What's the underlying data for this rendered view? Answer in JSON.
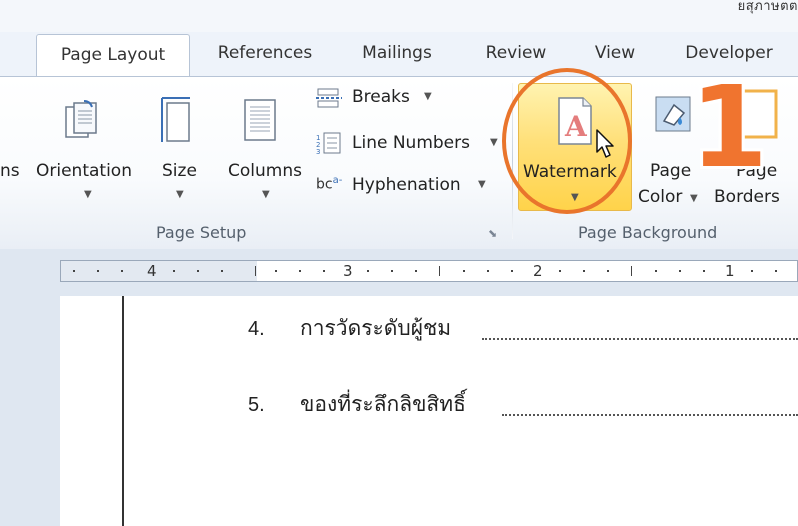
{
  "window": {
    "title_fragment": "ยสุภาษตต"
  },
  "tabs": [
    {
      "label": "Page Layout",
      "active": true
    },
    {
      "label": "References"
    },
    {
      "label": "Mailings"
    },
    {
      "label": "Review"
    },
    {
      "label": "View"
    },
    {
      "label": "Developer"
    }
  ],
  "ribbon": {
    "page_setup": {
      "label": "Page Setup",
      "margins_partial": "ns",
      "orientation": "Orientation",
      "size": "Size",
      "columns": "Columns",
      "breaks": "Breaks",
      "line_numbers": "Line Numbers",
      "hyphenation": "Hyphenation",
      "hyphen_icon_text": "bc"
    },
    "page_background": {
      "label": "Page Background",
      "watermark": "Watermark",
      "page_color_line1": "Page",
      "page_color_line2": "Color",
      "page_borders_line1": "Page",
      "page_borders_line2": "Borders"
    }
  },
  "annotation": {
    "step": "1",
    "ring_color": "#e9752c"
  },
  "ruler": {
    "numbers": [
      "4",
      "3",
      "2",
      "1"
    ]
  },
  "document": {
    "items": [
      {
        "num": "4.",
        "text": "การวัดระดับผู้ชม"
      },
      {
        "num": "5.",
        "text": "ของที่ระลึกลิขสิทธิ์"
      }
    ]
  },
  "colors": {
    "highlight": "#ffe07a",
    "accent_orange": "#f0742f"
  }
}
